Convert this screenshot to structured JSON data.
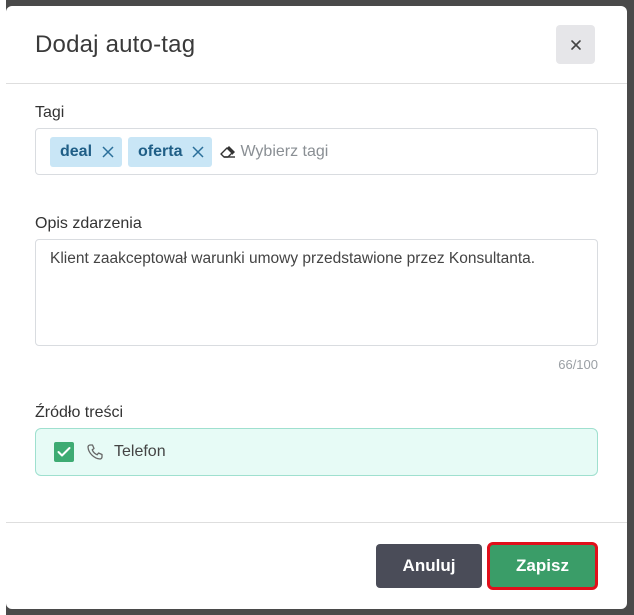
{
  "modal": {
    "title": "Dodaj auto-tag",
    "close_icon": "close-icon"
  },
  "tags_field": {
    "label": "Tagi",
    "tags": [
      {
        "label": "deal"
      },
      {
        "label": "oferta"
      }
    ],
    "placeholder": "Wybierz tagi",
    "eraser_icon": "eraser-icon"
  },
  "description_field": {
    "label": "Opis zdarzenia",
    "value": "Klient zaakceptował warunki umowy przedstawione przez Konsultanta.",
    "counter": "66/100"
  },
  "source_field": {
    "label": "Źródło treści",
    "checked": true,
    "option_label": "Telefon",
    "icon": "phone-icon"
  },
  "footer": {
    "cancel_label": "Anuluj",
    "save_label": "Zapisz"
  },
  "colors": {
    "tag_bg": "#c9e6f6",
    "tag_text": "#1f5e86",
    "source_bg": "#e7fbf6",
    "checkbox": "#3eab73",
    "cancel_button": "#4a4c58",
    "save_button": "#3a9d68",
    "highlight_outline": "#e10f1b"
  }
}
